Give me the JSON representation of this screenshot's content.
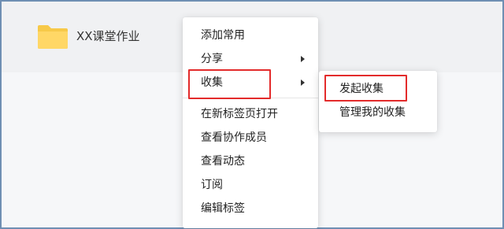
{
  "folder": {
    "name": "XX课堂作业",
    "icon": "folder-icon",
    "color": "#ffd766"
  },
  "context_menu": {
    "items": [
      {
        "label": "添加常用",
        "has_submenu": false
      },
      {
        "label": "分享",
        "has_submenu": true
      },
      {
        "label": "收集",
        "has_submenu": true,
        "highlighted": true
      },
      {
        "label": "在新标签页打开",
        "has_submenu": false
      },
      {
        "label": "查看协作成员",
        "has_submenu": false
      },
      {
        "label": "查看动态",
        "has_submenu": false
      },
      {
        "label": "订阅",
        "has_submenu": false
      },
      {
        "label": "编辑标签",
        "has_submenu": false
      }
    ]
  },
  "submenu": {
    "items": [
      {
        "label": "发起收集",
        "highlighted": true
      },
      {
        "label": "管理我的收集"
      }
    ]
  },
  "colors": {
    "highlight_border": "#e32b2b",
    "frame_border": "#6f8fb3"
  }
}
